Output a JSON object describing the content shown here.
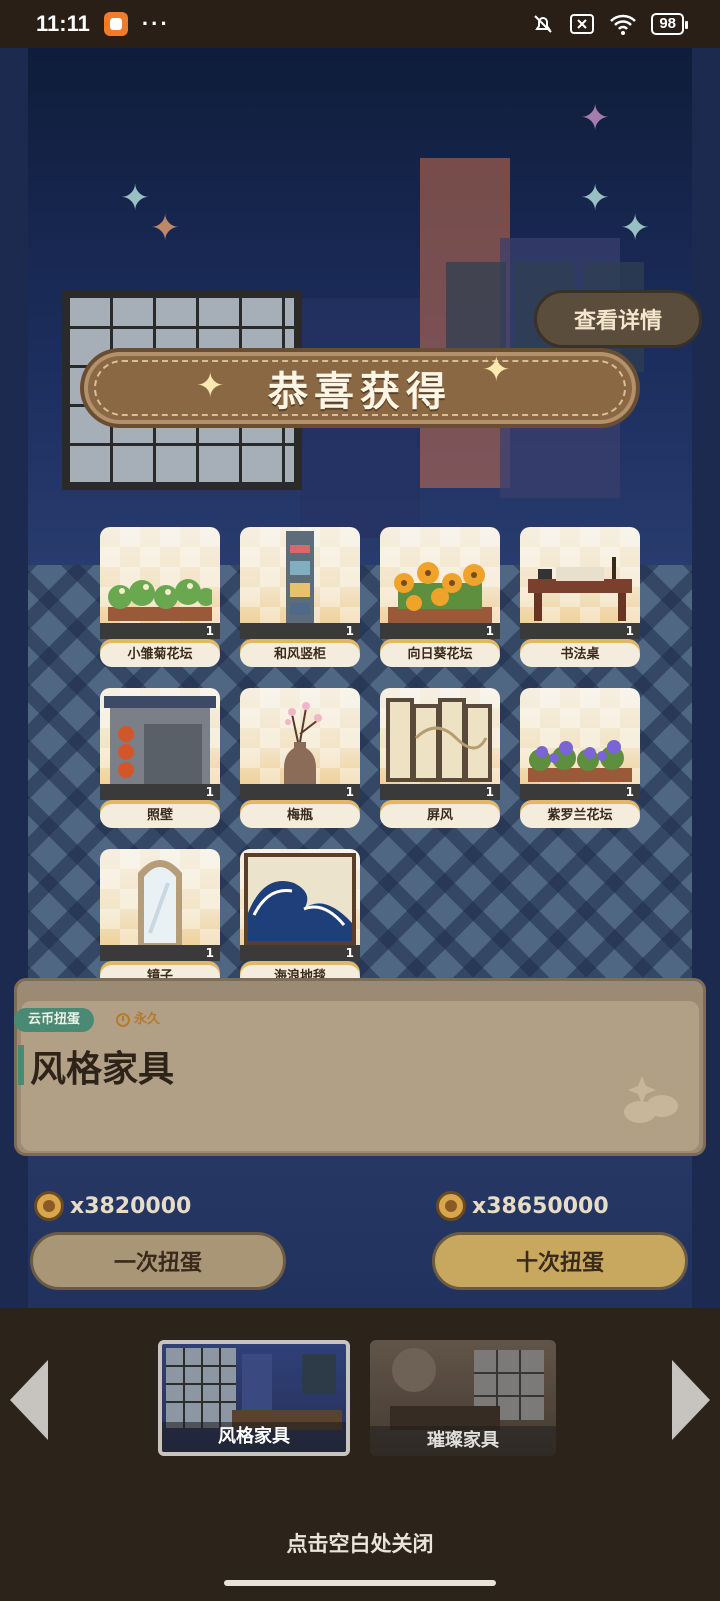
{
  "status_bar": {
    "time": "11:11",
    "overflow": "···",
    "battery": "98",
    "icons": [
      "app-notification-icon",
      "mute-icon",
      "sim-x-icon",
      "wifi-icon",
      "battery-icon"
    ]
  },
  "details_button": {
    "label": "查看详情"
  },
  "banner": {
    "title": "恭喜获得"
  },
  "items": [
    {
      "name": "小雏菊花坛",
      "qty": "1",
      "icon": "daisy-planter-icon"
    },
    {
      "name": "和风竖柜",
      "qty": "1",
      "icon": "japanese-tall-cabinet-icon"
    },
    {
      "name": "向日葵花坛",
      "qty": "1",
      "icon": "sunflower-planter-icon"
    },
    {
      "name": "书法桌",
      "qty": "1",
      "icon": "calligraphy-desk-icon"
    },
    {
      "name": "照壁",
      "qty": "1",
      "icon": "screen-wall-icon"
    },
    {
      "name": "梅瓶",
      "qty": "1",
      "icon": "plum-vase-icon"
    },
    {
      "name": "屏风",
      "qty": "1",
      "icon": "folding-screen-icon"
    },
    {
      "name": "紫罗兰花坛",
      "qty": "1",
      "icon": "violet-planter-icon"
    },
    {
      "name": "镜子",
      "qty": "1",
      "icon": "mirror-icon"
    },
    {
      "name": "海浪地毯",
      "qty": "1",
      "icon": "wave-rug-icon"
    }
  ],
  "panel": {
    "tag": "云币扭蛋",
    "duration": "永久",
    "title": "风格家具"
  },
  "costs": {
    "single": "x3820000",
    "ten": "x38650000"
  },
  "buttons": {
    "draw_once": "一次扭蛋",
    "draw_ten": "十次扭蛋"
  },
  "carousel": {
    "items": [
      {
        "label": "风格家具",
        "active": true
      },
      {
        "label": "璀璨家具",
        "active": false
      }
    ]
  },
  "close_hint": "点击空白处关闭",
  "colors": {
    "banner": "#8a6844",
    "tag": "#4a8a74",
    "draw_ten": "#c8a85f",
    "draw_once": "#a99676"
  }
}
